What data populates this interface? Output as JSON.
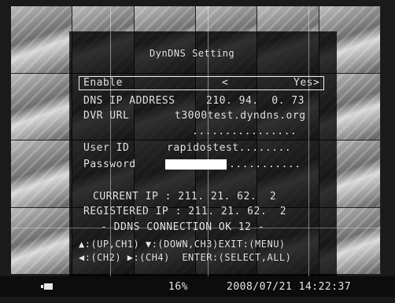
{
  "dialog": {
    "title": "DynDNS Setting",
    "enable": {
      "label": "Enable",
      "arrow_left": "<",
      "value": "Yes>"
    },
    "dns_ip": {
      "label": "DNS IP ADDRESS",
      "value": "210. 94.  0. 73"
    },
    "dvr_url": {
      "label": "DVR URL",
      "value": "t3000test.dyndns.org",
      "continuation": "................"
    },
    "user_id": {
      "label": "User ID",
      "value": "rapidostest........"
    },
    "password": {
      "label": "Password",
      "dots": "..........."
    },
    "current_ip": "CURRENT IP : 211. 21. 62.  2",
    "registered_ip": "REGISTERED IP : 211. 21. 62.  2",
    "connection": "- DDNS CONNECTION OK 12 -",
    "help_line1": "▲:(UP,CH1) ▼:(DOWN,CH3)EXIT:(MENU)",
    "help_line2": "◀:(CH2) ▶:(CH4)  ENTER:(SELECT,ALL)"
  },
  "status_bar": {
    "camera_icon": "camera-icon",
    "percent": "16%",
    "datetime": "2008/07/21 14:22:37"
  }
}
